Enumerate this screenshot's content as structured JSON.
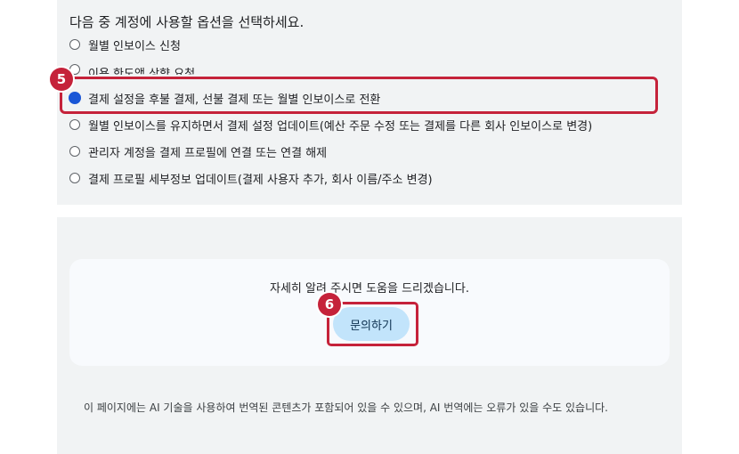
{
  "question": "다음 중 계정에 사용할 옵션을 선택하세요.",
  "options": [
    {
      "label": "월별 인보이스 신청",
      "selected": false
    },
    {
      "label": "이용 한도액 상향 요청",
      "selected": false
    },
    {
      "label": "결제 설정을 후불 결제, 선불 결제 또는 월별 인보이스로 전환",
      "selected": true
    },
    {
      "label": "월별 인보이스를 유지하면서 결제 설정 업데이트(예산 주문 수정 또는 결제를 다른 회사 인보이스로 변경)",
      "selected": false
    },
    {
      "label": "관리자 계정을 결제 프로필에 연결 또는 연결 해제",
      "selected": false
    },
    {
      "label": "결제 프로필 세부정보 업데이트(결제 사용자 추가, 회사 이름/주소 변경)",
      "selected": false
    }
  ],
  "steps": {
    "step5": "5",
    "step6": "6"
  },
  "help": {
    "text": "자세히 알려 주시면 도움을 드리겠습니다.",
    "contact_label": "문의하기"
  },
  "disclaimer": "이 페이지에는 AI 기술을 사용하여 번역된 콘텐츠가 포함되어 있을 수 있으며, AI 번역에는 오류가 있을 수도 있습니다.",
  "colors": {
    "accent_red": "#c5223a",
    "radio_selected": "#1a56d6",
    "button_bg": "#c2e4fb"
  }
}
